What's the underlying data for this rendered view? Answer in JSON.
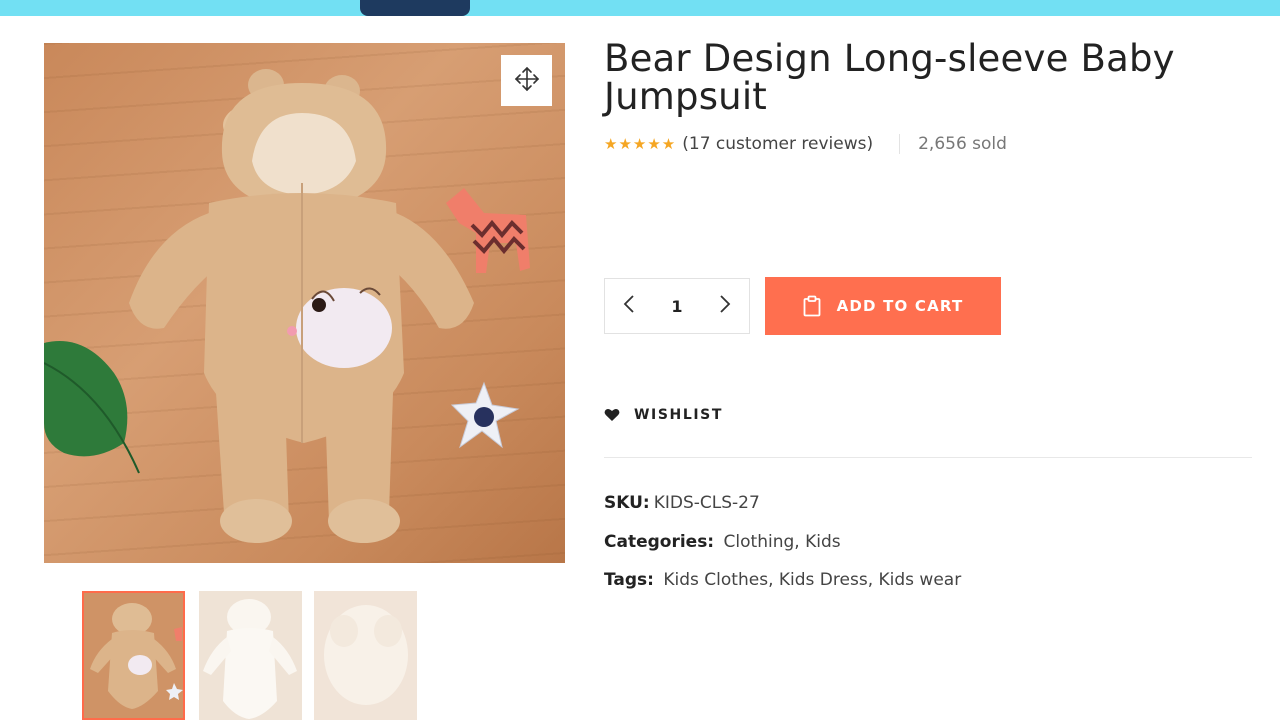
{
  "product": {
    "title": "Bear Design Long-sleeve Baby Jumpsuit",
    "rating_stars": "★★★★★",
    "reviews_text": "(17 customer reviews)",
    "sold_text": "2,656 sold"
  },
  "cart": {
    "quantity": "1",
    "add_to_cart_label": "ADD TO CART"
  },
  "wishlist": {
    "label": "WISHLIST"
  },
  "meta": {
    "sku_label": "SKU:",
    "sku_value": "KIDS-CLS-27",
    "categories_label": "Categories:",
    "categories": [
      "Clothing",
      "Kids"
    ],
    "tags_label": "Tags:",
    "tags": [
      "Kids Clothes",
      "Kids Dress",
      "Kids wear"
    ],
    "separator": ","
  },
  "colors": {
    "accent": "#ff6f4f",
    "star": "#f5a623",
    "banner": "#72e0f3"
  },
  "icons": [
    "expand-icon",
    "chevron-left-icon",
    "chevron-right-icon",
    "clipboard-icon",
    "heart-icon"
  ]
}
